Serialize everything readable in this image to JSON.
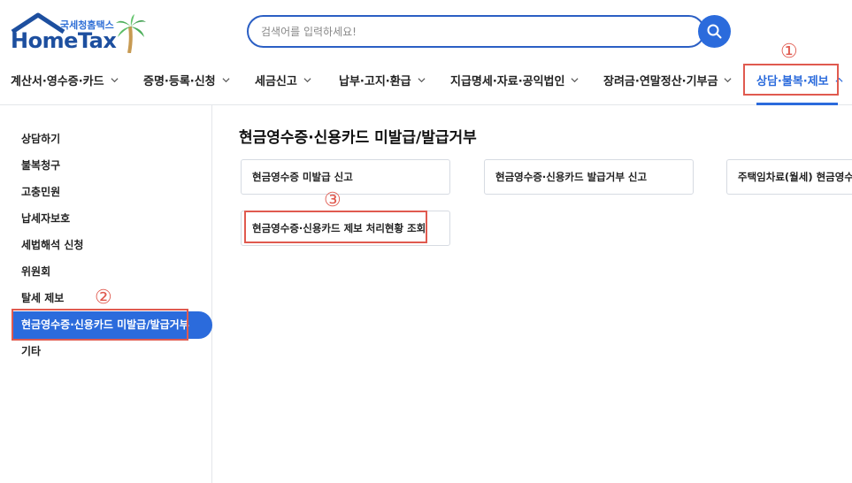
{
  "brand": {
    "sub": "국세청홈택스",
    "main": "HomeTax"
  },
  "search": {
    "placeholder": "검색어를 입력하세요!",
    "value": ""
  },
  "gnb": {
    "items": [
      {
        "label": "계산서·영수증·카드"
      },
      {
        "label": "증명·등록·신청"
      },
      {
        "label": "세금신고"
      },
      {
        "label": "납부·고지·환급"
      },
      {
        "label": "지급명세·자료·공익법인"
      },
      {
        "label": "장려금·연말정산·기부금"
      },
      {
        "label": "상담·불복·제보"
      }
    ],
    "active_index": 6
  },
  "sidebar": {
    "items": [
      {
        "label": "상담하기"
      },
      {
        "label": "불복청구"
      },
      {
        "label": "고충민원"
      },
      {
        "label": "납세자보호"
      },
      {
        "label": "세법해석 신청"
      },
      {
        "label": "위원회"
      },
      {
        "label": "탈세 제보"
      },
      {
        "label": "현금영수증·신용카드 미발급/발급거부"
      },
      {
        "label": "기타"
      }
    ],
    "active_index": 7
  },
  "main": {
    "title": "현금영수증·신용카드 미발급/발급거부",
    "cards": [
      {
        "label": "현금영수증 미발급 신고"
      },
      {
        "label": "현금영수증·신용카드 발급거부 신고"
      },
      {
        "label": "주택임차료(월세) 현금영수증 발급"
      },
      {
        "label": "현금영수증·신용카드 제보 처리현황 조회"
      }
    ]
  },
  "annotations": {
    "one": "①",
    "two": "②",
    "three": "③",
    "color": "#e05a4f"
  },
  "colors": {
    "accent": "#2b6bdc",
    "brand": "#1d4f9f"
  }
}
